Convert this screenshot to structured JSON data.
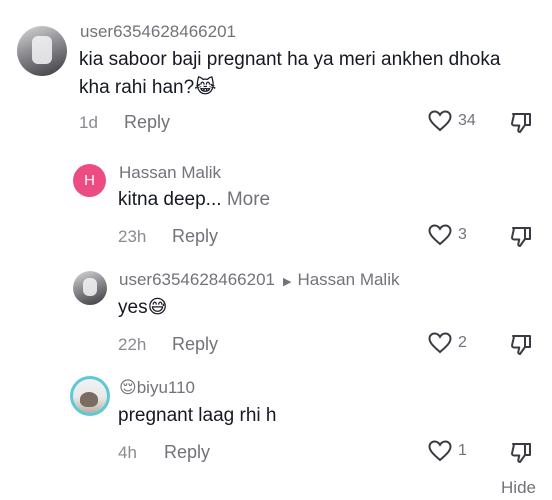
{
  "comments": [
    {
      "username": "user6354628466201",
      "text_line1": "kia saboor baji pregnant ha ya meri ankhen dhoka",
      "text_line2": "kha rahi han?😹",
      "age": "1d",
      "reply_label": "Reply",
      "likes": "34"
    },
    {
      "username": "Hassan Malik",
      "avatar_initial": "H",
      "text": "kitna deep...",
      "more_label": "More",
      "age": "23h",
      "reply_label": "Reply",
      "likes": "3"
    },
    {
      "username": "user6354628466201",
      "reply_to": "Hassan Malik",
      "text": "yes😅",
      "age": "22h",
      "reply_label": "Reply",
      "likes": "2"
    },
    {
      "username": "😌biyu110",
      "text": "pregnant laag rhi h",
      "age": "4h",
      "reply_label": "Reply",
      "likes": "1"
    }
  ],
  "footer": {
    "hide_label": "Hide"
  },
  "colors": {
    "initial_avatar": "#ec4c82",
    "ring": "#5ec9d6",
    "muted": "#72737a"
  }
}
